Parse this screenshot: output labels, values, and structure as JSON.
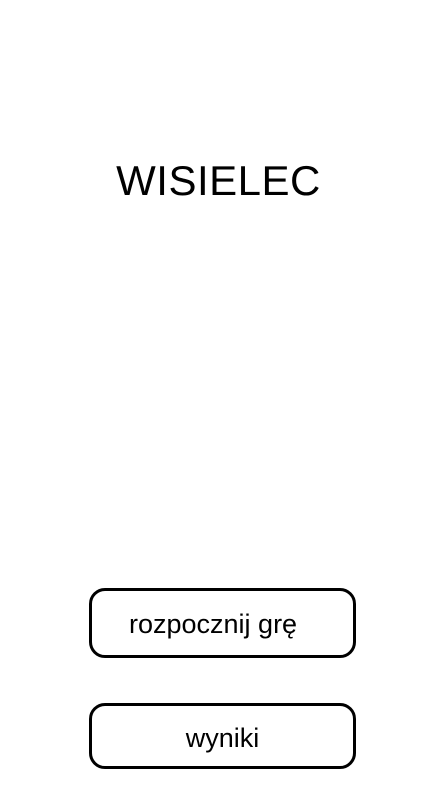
{
  "app": {
    "title": "WISIELEC"
  },
  "menu": {
    "start_label": "rozpocznij grę",
    "results_label": "wyniki"
  },
  "colors": {
    "background": "#ffffff",
    "foreground": "#000000",
    "button_border": "#000000"
  }
}
